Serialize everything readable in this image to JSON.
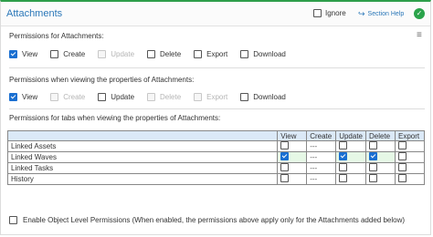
{
  "header": {
    "title": "Attachments",
    "ignore_label": "Ignore",
    "help_label": "Section Help"
  },
  "sections": {
    "permissions": {
      "title": "Permissions for Attachments:",
      "options": [
        {
          "label": "View",
          "checked": true,
          "disabled": false
        },
        {
          "label": "Create",
          "checked": false,
          "disabled": false
        },
        {
          "label": "Update",
          "checked": false,
          "disabled": true
        },
        {
          "label": "Delete",
          "checked": false,
          "disabled": false
        },
        {
          "label": "Export",
          "checked": false,
          "disabled": false
        },
        {
          "label": "Download",
          "checked": false,
          "disabled": false
        }
      ]
    },
    "properties": {
      "title": "Permissions when viewing the properties of Attachments:",
      "options": [
        {
          "label": "View",
          "checked": true,
          "disabled": false
        },
        {
          "label": "Create",
          "checked": false,
          "disabled": true
        },
        {
          "label": "Update",
          "checked": false,
          "disabled": false
        },
        {
          "label": "Delete",
          "checked": false,
          "disabled": true
        },
        {
          "label": "Export",
          "checked": false,
          "disabled": true
        },
        {
          "label": "Download",
          "checked": false,
          "disabled": false
        }
      ]
    },
    "tabs": {
      "title": "Permissions for tabs when viewing the properties of Attachments:",
      "columns": [
        "View",
        "Create",
        "Update",
        "Delete",
        "Export"
      ],
      "dash": "---",
      "rows": [
        {
          "name": "Linked Assets",
          "cells": [
            "cb",
            "dash",
            "cb",
            "cb",
            "cb"
          ],
          "checked": [
            false,
            false,
            false,
            false,
            false
          ]
        },
        {
          "name": "Linked Waves",
          "cells": [
            "cb",
            "dash",
            "cb",
            "cb",
            "cb"
          ],
          "checked": [
            true,
            false,
            true,
            true,
            false
          ]
        },
        {
          "name": "Linked Tasks",
          "cells": [
            "cb",
            "dash",
            "cb",
            "cb",
            "cb"
          ],
          "checked": [
            false,
            false,
            false,
            false,
            false
          ]
        },
        {
          "name": "History",
          "cells": [
            "cb",
            "dash",
            "cb",
            "cb",
            "cb"
          ],
          "checked": [
            false,
            false,
            false,
            false,
            false
          ]
        }
      ]
    }
  },
  "footer": {
    "label": "Enable Object Level Permissions (When enabled, the permissions above apply only for the Attachments added below)",
    "checked": false
  },
  "colors": {
    "accent_green": "#2e9e4b",
    "link_blue": "#2a77b8",
    "checkbox_blue": "#1a6fd1",
    "table_header": "#dbe9f7",
    "row_highlight": "#e6f8e6"
  },
  "icons": {
    "help": "arrow-redo-icon",
    "status": "checkmark-circle-icon",
    "menu": "hamburger-menu-icon"
  }
}
